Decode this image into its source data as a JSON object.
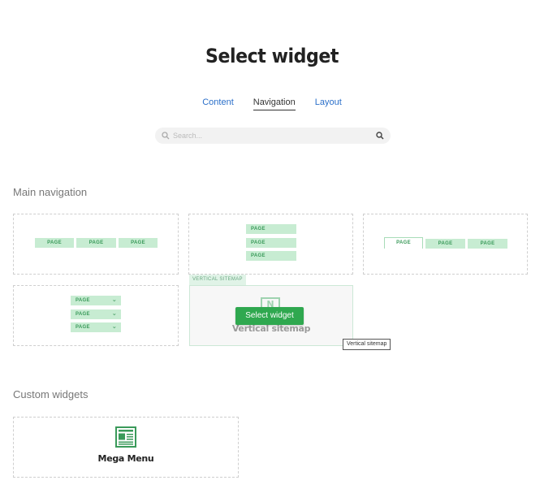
{
  "header": {
    "title": "Select widget"
  },
  "tabs": [
    {
      "label": "Content"
    },
    {
      "label": "Navigation"
    },
    {
      "label": "Layout"
    }
  ],
  "search": {
    "placeholder": "Search..."
  },
  "sections": {
    "main_navigation": "Main navigation",
    "custom_widgets": "Custom widgets"
  },
  "page_label": "PAGE",
  "hover": {
    "tag": "VERTICAL SITEMAP",
    "icon_letter": "N",
    "label": "Vertical sitemap",
    "select_button": "Select widget",
    "tooltip": "Vertical sitemap"
  },
  "custom": {
    "mega_menu_label": "Mega Menu"
  },
  "colors": {
    "accent_green": "#2fa84f",
    "page_chip": "#c7ecd2",
    "link_blue": "#2a6fc9"
  }
}
